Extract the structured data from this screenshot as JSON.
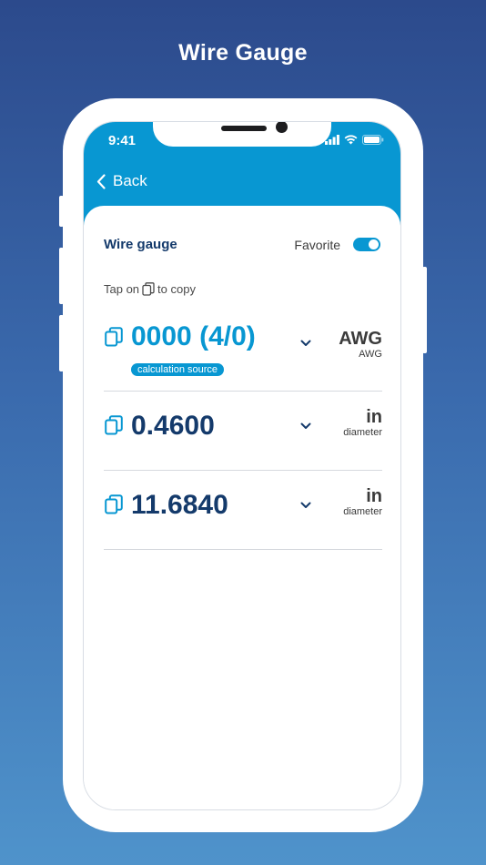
{
  "header": {
    "title": "Wire Gauge"
  },
  "status_bar": {
    "time": "9:41",
    "icons": [
      "signal-icon",
      "wifi-icon",
      "battery-icon"
    ]
  },
  "nav": {
    "back_label": "Back"
  },
  "card": {
    "title": "Wire gauge",
    "favorite_label": "Favorite",
    "favorite_on": true,
    "hint_before": "Tap on",
    "hint_after": "to copy"
  },
  "rows": [
    {
      "value": "0000 (4/0)",
      "badge": "calculation source",
      "unit": "AWG",
      "unit_sub": "AWG"
    },
    {
      "value": "0.4600",
      "unit": "in",
      "unit_sub": "diameter"
    },
    {
      "value": "11.6840",
      "unit": "in",
      "unit_sub": "diameter"
    }
  ],
  "colors": {
    "accent": "#0897d2",
    "value_text": "#143a6b",
    "background_top": "#2c4a8c",
    "background_bottom": "#4f93cb"
  }
}
